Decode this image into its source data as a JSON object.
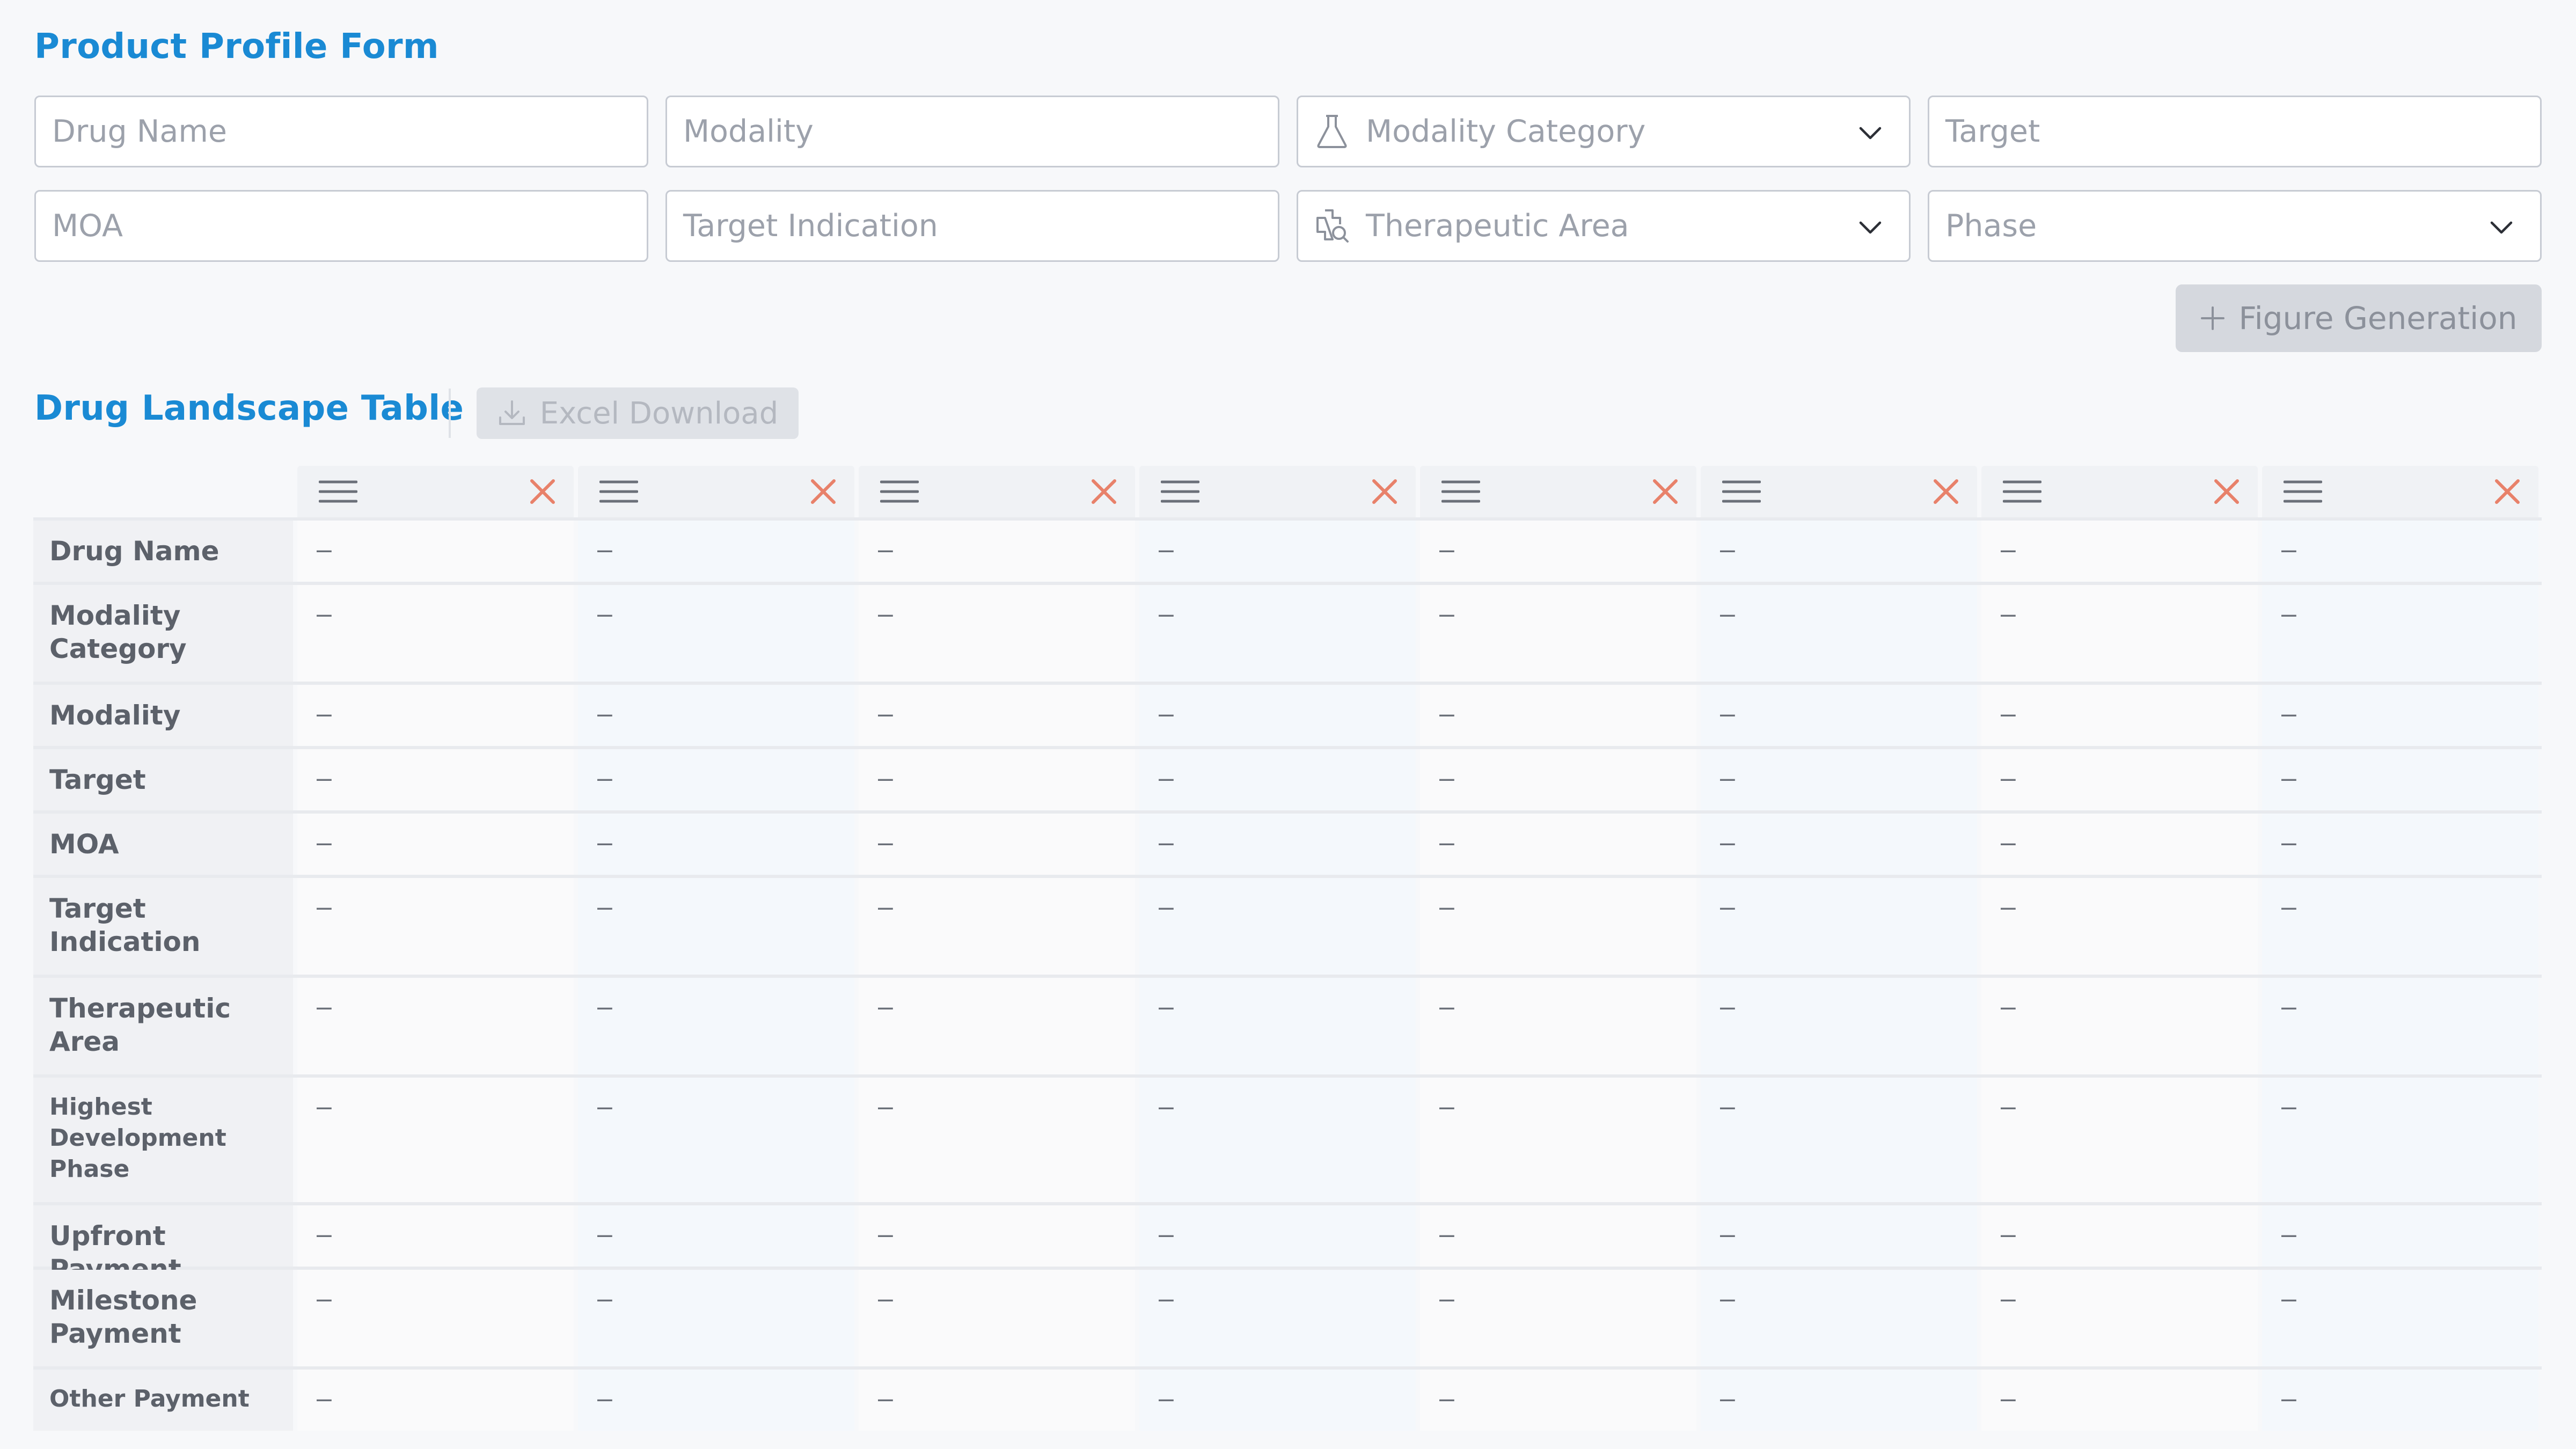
{
  "form": {
    "title": "Product Profile Form",
    "fields": {
      "drug_name": "Drug Name",
      "modality": "Modality",
      "modality_category": "Modality Category",
      "target": "Target",
      "moa": "MOA",
      "target_indication": "Target Indication",
      "therapeutic_area": "Therapeutic Area",
      "phase": "Phase"
    },
    "figure_button": "Figure Generation"
  },
  "table": {
    "title": "Drug Landscape Table",
    "excel_button": "Excel Download",
    "columns": 8,
    "rows": [
      "Drug Name",
      "Modality Category",
      "Modality",
      "Target",
      "MOA",
      "Target Indication",
      "Therapeutic Area",
      "Highest Development Phase",
      "Upfront Payment",
      "Milestone Payment",
      "Other Payment"
    ],
    "empty_value": "–"
  },
  "colors": {
    "accent": "#1a8ad4",
    "delete": "#e8816a",
    "border": "#c7cbd3"
  },
  "icons": {
    "modality_category": "flask-icon",
    "therapeutic_area": "medical-search-icon",
    "dropdown": "chevron-down-icon",
    "column_menu": "menu-icon",
    "column_delete": "close-icon",
    "excel": "download-icon",
    "figure": "plus-icon"
  }
}
